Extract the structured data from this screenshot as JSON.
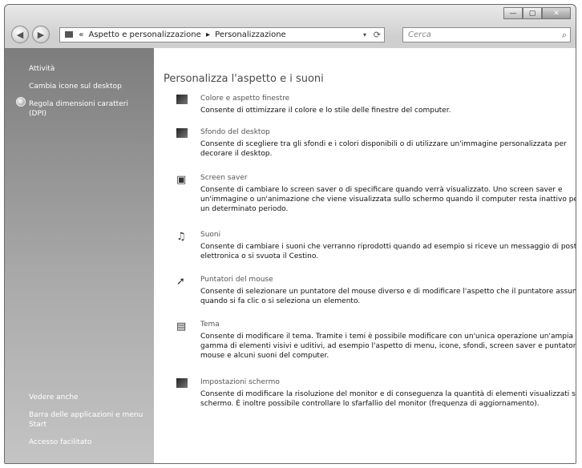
{
  "window": {
    "minimize_label": "—",
    "maximize_label": "▢",
    "close_label": "✕"
  },
  "address_bar": {
    "prefix": "«",
    "crumbs": [
      "Aspetto e personalizzazione",
      "Personalizzazione"
    ],
    "separator": "▸",
    "dropdown": "▾",
    "refresh": "⟳"
  },
  "search": {
    "placeholder": "Cerca",
    "icon": "search-icon"
  },
  "sidebar": {
    "tasks": [
      {
        "label": "Attività"
      },
      {
        "label": "Cambia icone sul desktop"
      },
      {
        "label": "Regola dimensioni caratteri (DPI)",
        "icon": "shield-icon"
      }
    ],
    "see_also_heading": "Vedere anche",
    "see_also": [
      {
        "label": "Barra delle applicazioni e menu Start"
      },
      {
        "label": "Accesso facilitato"
      }
    ]
  },
  "main": {
    "title": "Personalizza l'aspetto e i suoni",
    "items": [
      {
        "title": "Colore e aspetto finestre",
        "description": "Consente di ottimizzare il colore e lo stile delle finestre del computer.",
        "icon": "window-color-icon"
      },
      {
        "title": "Sfondo del desktop",
        "description": "Consente di scegliere tra gli sfondi e i colori disponibili o di utilizzare un'immagine personalizzata per decorare il desktop.",
        "icon": "desktop-background-icon"
      },
      {
        "title": "Screen saver",
        "description": "Consente di cambiare lo screen saver o di specificare quando verrà visualizzato. Uno screen saver e un'immagine o un'animazione che viene visualizzata sullo schermo quando il computer resta inattivo per un determinato periodo.",
        "icon": "screen-saver-icon"
      },
      {
        "title": "Suoni",
        "description": "Consente di cambiare i suoni che verranno riprodotti quando ad esempio si riceve un messaggio di posta elettronica o si svuota il Cestino.",
        "icon": "sounds-icon"
      },
      {
        "title": "Puntatori del mouse",
        "description": "Consente di selezionare un puntatore del mouse diverso e di modificare l'aspetto che il puntatore assumerà quando si fa clic o si seleziona un elemento.",
        "icon": "mouse-pointer-icon"
      },
      {
        "title": "Tema",
        "description": "Consente di modificare il tema. Tramite i temi è possibile modificare con un'unica operazione un'ampia gamma di elementi visivi e uditivi, ad esempio l'aspetto di menu, icone, sfondi, screen saver e puntatori del mouse e alcuni suoni del computer.",
        "icon": "theme-icon"
      },
      {
        "title": "Impostazioni schermo",
        "description": "Consente di modificare la risoluzione del monitor e di conseguenza la quantità di elementi visualizzati sullo schermo. È inoltre possibile controllare lo sfarfallio del monitor (frequenza di aggiornamento).",
        "icon": "display-settings-icon"
      }
    ]
  }
}
